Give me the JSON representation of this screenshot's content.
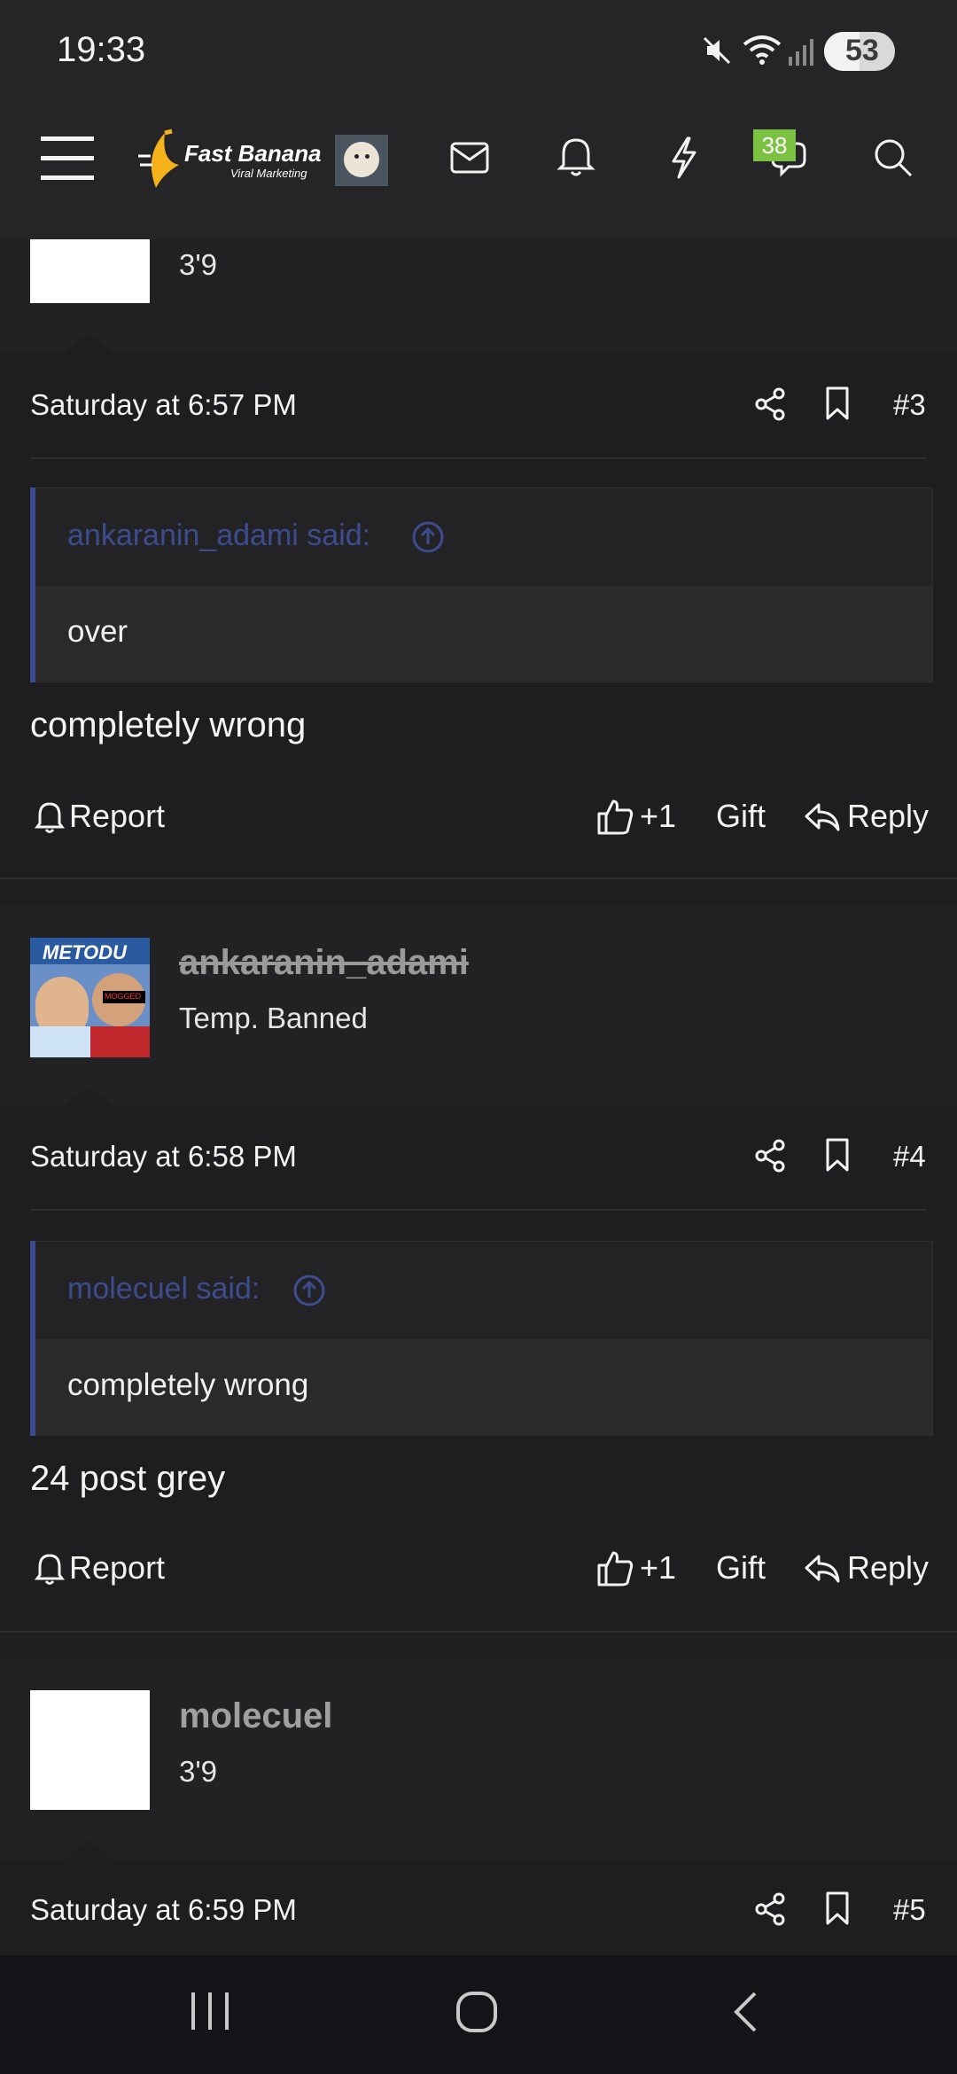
{
  "status_bar": {
    "time": "19:33",
    "battery": "53"
  },
  "header": {
    "logo_text": "Fast Banana",
    "logo_subtext": "Viral Marketing",
    "chat_badge": "38"
  },
  "posts": [
    {
      "username": "",
      "user_title": "3'9",
      "date": "Saturday at 6:57 PM",
      "number": "#3",
      "quote_author": "ankaranin_adami said:",
      "quote_text": "over",
      "text": "completely wrong",
      "actions": {
        "report": "Report",
        "like": "+1",
        "gift": "Gift",
        "reply": "Reply"
      }
    },
    {
      "username": "ankaranin_adami",
      "user_title": "Temp. Banned",
      "avatar_text": "METODU",
      "avatar_tag": "MOGGED",
      "date": "Saturday at 6:58 PM",
      "number": "#4",
      "quote_author": "molecuel said:",
      "quote_text": "completely wrong",
      "text": "24 post grey",
      "actions": {
        "report": "Report",
        "like": "+1",
        "gift": "Gift",
        "reply": "Reply"
      }
    },
    {
      "username": "molecuel",
      "user_title": "3'9",
      "date": "Saturday at 6:59 PM",
      "number": "#5"
    }
  ],
  "colors": {
    "accent_quote": "#3b4a8f",
    "badge": "#7bc142",
    "background": "#1f1f21"
  }
}
